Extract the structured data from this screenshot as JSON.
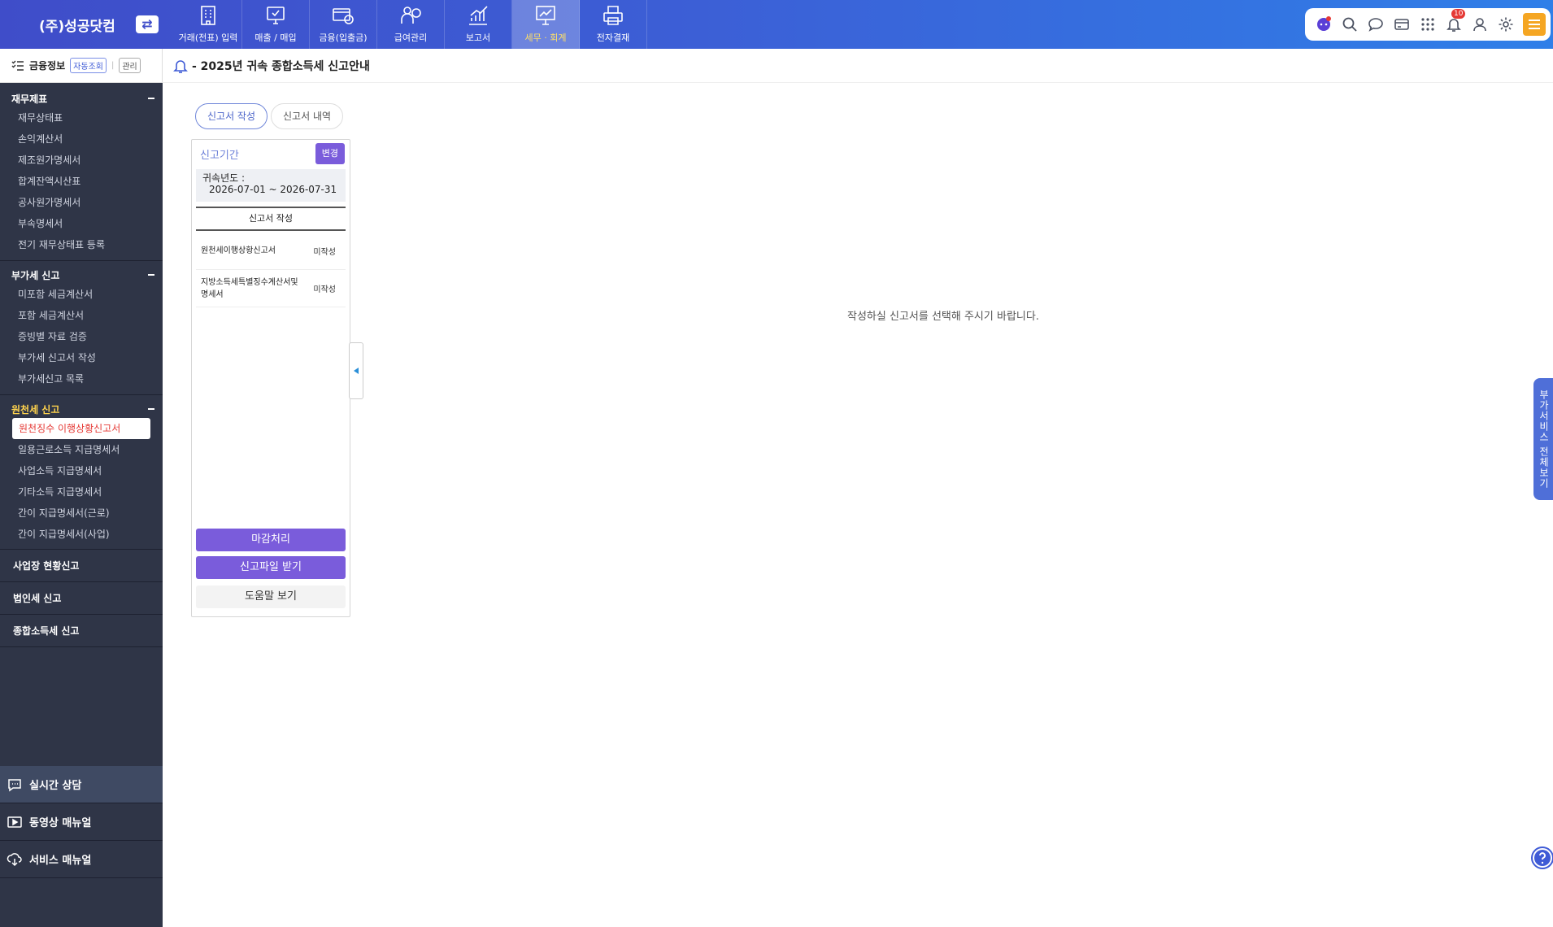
{
  "company": {
    "name": "(주)성공닷컴",
    "switch_icon": "⇄"
  },
  "menu": [
    {
      "label": "거래(전표) 입력",
      "icon": "building-icon"
    },
    {
      "label": "매출 / 매입",
      "icon": "monitor-check-icon"
    },
    {
      "label": "금융(입출금)",
      "icon": "card-coin-icon"
    },
    {
      "label": "급여관리",
      "icon": "person-money-icon"
    },
    {
      "label": "보고서",
      "icon": "chart-up-icon"
    },
    {
      "label": "세무 · 회계",
      "icon": "presentation-chart-icon",
      "active": true
    },
    {
      "label": "전자결재",
      "icon": "printer-doc-icon"
    }
  ],
  "tools": {
    "notification_count": "10"
  },
  "sidebar": {
    "finance": {
      "label": "금융정보",
      "auto": "자동조회",
      "manage": "관리"
    },
    "sections": [
      {
        "title": "재무제표",
        "items": [
          "재무상태표",
          "손익계산서",
          "제조원가명세서",
          "합계잔액시산표",
          "공사원가명세서",
          "부속명세서",
          "전기 재무상태표 등록"
        ]
      },
      {
        "title": "부가세 신고",
        "items": [
          "미포함 세금계산서",
          "포함 세금계산서",
          "증빙별 자료 검증",
          "부가세 신고서 작성",
          "부가세신고 목록"
        ]
      },
      {
        "title": "원천세 신고",
        "items": [
          "원천징수 이행상황신고서",
          "일용근로소득 지급명세서",
          "사업소득 지급명세서",
          "기타소득 지급명세서",
          "간이 지급명세서(근로)",
          "간이 지급명세서(사업)"
        ]
      }
    ],
    "flat": [
      "사업장 현황신고",
      "법인세 신고",
      "종합소득세 신고"
    ],
    "bottom": [
      {
        "label": "실시간 상담",
        "icon": "chat-icon"
      },
      {
        "label": "동영상 매뉴얼",
        "icon": "video-icon"
      },
      {
        "label": "서비스 매뉴얼",
        "icon": "cloud-download-icon"
      }
    ]
  },
  "page": {
    "title": "- 2025년 귀속 종합소득세 신고안내"
  },
  "tabs": [
    "신고서 작성",
    "신고서 내역"
  ],
  "panel": {
    "period_label": "신고기간",
    "change_button": "변경",
    "year_label": "귀속년도 :",
    "year_range": "2026-07-01 ~ 2026-07-31",
    "list_header": "신고서 작성",
    "rows": [
      {
        "name": "원천세이행상황신고서",
        "status": "미작성"
      },
      {
        "name": "지방소득세특별징수계산서및명세서",
        "status": "미작성"
      }
    ],
    "btn_close": "마감처리",
    "btn_file": "신고파일 받기",
    "btn_help": "도움말 보기"
  },
  "empty_message": "작성하실 신고서를 선택해 주시기 바랍니다.",
  "side_tab": "부가서비스 전체보기"
}
